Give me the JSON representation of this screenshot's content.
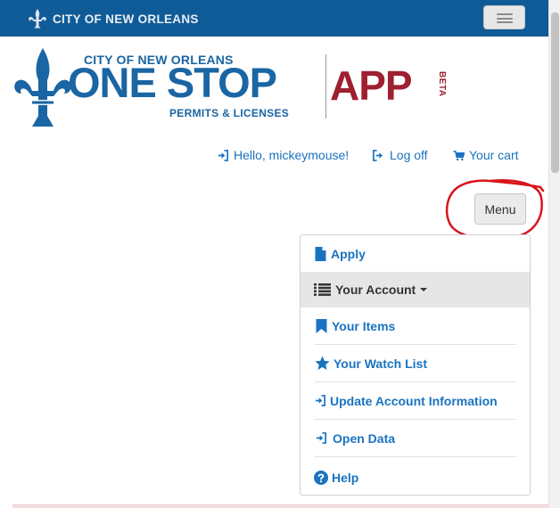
{
  "topbar": {
    "brand_text": "CITY OF NEW ORLEANS",
    "brand_icon": "fleur-de-lis-icon",
    "menu_toggle_icon": "hamburger-icon",
    "color": "#0f5b97"
  },
  "logo": {
    "city": "CITY OF NEW ORLEANS",
    "onestop": "ONE STOP",
    "permits": "PERMITS & LICENSES",
    "app": "APP",
    "beta": "BETA",
    "primary_color": "#1a65a3",
    "accent_color": "#9e2030"
  },
  "user_links": {
    "hello": "Hello, mickeymouse!",
    "logoff": "Log off",
    "cart": "Your cart"
  },
  "menu_button": {
    "label": "Menu"
  },
  "dropdown": {
    "apply": "Apply",
    "your_account": "Your Account",
    "your_items": "Your Items",
    "watch_list": "Your Watch List",
    "update_account": "Update Account Information",
    "open_data": "Open Data",
    "help": "Help"
  },
  "colors": {
    "link": "#1a73c0",
    "annotation": "#d8141c"
  }
}
